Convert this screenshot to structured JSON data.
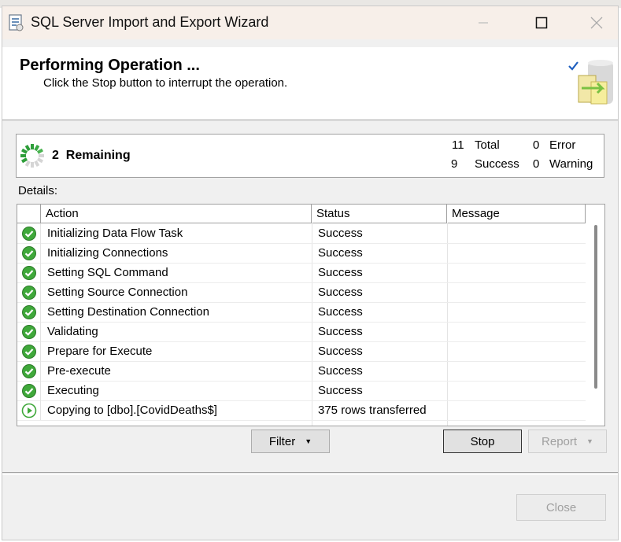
{
  "window": {
    "title": "SQL Server Import and Export Wizard"
  },
  "header": {
    "title": "Performing Operation ...",
    "subtitle": "Click the Stop button to interrupt the operation."
  },
  "progress": {
    "remaining_count": "2",
    "remaining_label": "Remaining",
    "total_count": "11",
    "total_label": "Total",
    "success_count": "9",
    "success_label": "Success",
    "error_count": "0",
    "error_label": "Error",
    "warning_count": "0",
    "warning_label": "Warning"
  },
  "details": {
    "label": "Details:",
    "columns": [
      "Action",
      "Status",
      "Message"
    ],
    "rows": [
      {
        "icon": "success-check-icon",
        "action": "Initializing Data Flow Task",
        "status": "Success",
        "message": ""
      },
      {
        "icon": "success-check-icon",
        "action": "Initializing Connections",
        "status": "Success",
        "message": ""
      },
      {
        "icon": "success-check-icon",
        "action": "Setting SQL Command",
        "status": "Success",
        "message": ""
      },
      {
        "icon": "success-check-icon",
        "action": "Setting Source Connection",
        "status": "Success",
        "message": ""
      },
      {
        "icon": "success-check-icon",
        "action": "Setting Destination Connection",
        "status": "Success",
        "message": ""
      },
      {
        "icon": "success-check-icon",
        "action": "Validating",
        "status": "Success",
        "message": ""
      },
      {
        "icon": "success-check-icon",
        "action": "Prepare for Execute",
        "status": "Success",
        "message": ""
      },
      {
        "icon": "success-check-icon",
        "action": "Pre-execute",
        "status": "Success",
        "message": ""
      },
      {
        "icon": "success-check-icon",
        "action": "Executing",
        "status": "Success",
        "message": ""
      },
      {
        "icon": "in-progress-play-icon",
        "action": "Copying to [dbo].[CovidDeaths$]",
        "status": "375 rows transferred",
        "message": ""
      }
    ]
  },
  "buttons": {
    "filter": "Filter",
    "stop": "Stop",
    "report": "Report",
    "close": "Close"
  },
  "colors": {
    "success_green": "#3fa83a",
    "titlebar": "#f7efe9",
    "window_bg": "#f0f0f0"
  }
}
